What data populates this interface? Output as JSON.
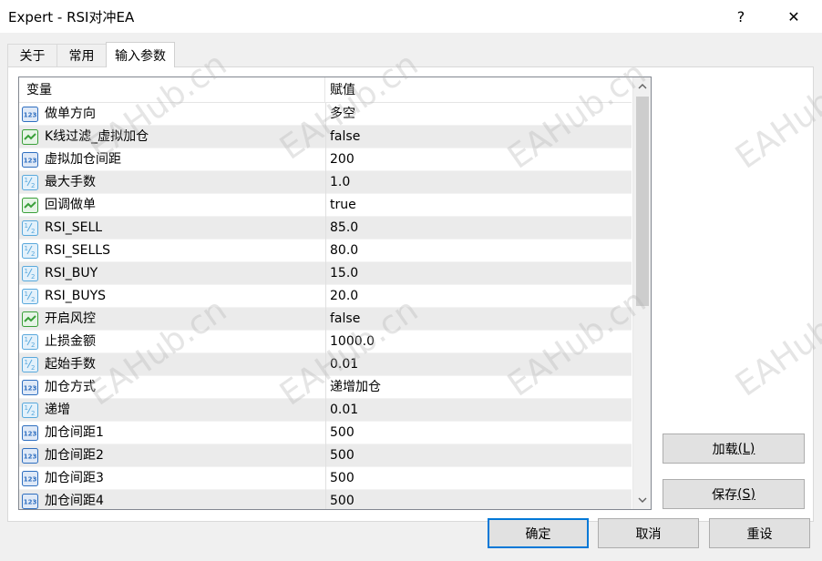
{
  "window": {
    "title": "Expert - RSI对冲EA",
    "help_label": "?",
    "close_label": "✕"
  },
  "tabs": [
    {
      "label": "关于"
    },
    {
      "label": "常用"
    },
    {
      "label": "输入参数"
    }
  ],
  "grid": {
    "headers": {
      "variable": "变量",
      "value": "赋值"
    },
    "rows": [
      {
        "name": "做单方向",
        "value": "多空",
        "icon": "enum-icon"
      },
      {
        "name": "K线过滤_虚拟加仓",
        "value": "false",
        "icon": "bool-icon"
      },
      {
        "name": "虚拟加仓间距",
        "value": "200",
        "icon": "int-icon"
      },
      {
        "name": "最大手数",
        "value": "1.0",
        "icon": "double-icon"
      },
      {
        "name": "回调做单",
        "value": "true",
        "icon": "bool-icon"
      },
      {
        "name": "RSI_SELL",
        "value": "85.0",
        "icon": "double-icon"
      },
      {
        "name": "RSI_SELLS",
        "value": "80.0",
        "icon": "double-icon"
      },
      {
        "name": "RSI_BUY",
        "value": "15.0",
        "icon": "double-icon"
      },
      {
        "name": "RSI_BUYS",
        "value": "20.0",
        "icon": "double-icon"
      },
      {
        "name": "开启风控",
        "value": "false",
        "icon": "bool-icon"
      },
      {
        "name": "止损金额",
        "value": "1000.0",
        "icon": "double-icon"
      },
      {
        "name": "起始手数",
        "value": "0.01",
        "icon": "double-icon"
      },
      {
        "name": "加仓方式",
        "value": "递增加仓",
        "icon": "enum-icon"
      },
      {
        "name": "递增",
        "value": "0.01",
        "icon": "double-icon"
      },
      {
        "name": "加仓间距1",
        "value": "500",
        "icon": "int-icon"
      },
      {
        "name": "加仓间距2",
        "value": "500",
        "icon": "int-icon"
      },
      {
        "name": "加仓间距3",
        "value": "500",
        "icon": "int-icon"
      },
      {
        "name": "加仓间距4",
        "value": "500",
        "icon": "int-icon"
      }
    ]
  },
  "buttons": {
    "load": {
      "label": "加载",
      "accel": "(L)"
    },
    "save": {
      "label": "保存",
      "accel": "(S)"
    },
    "ok": "确定",
    "cancel": "取消",
    "reset": "重设"
  },
  "watermark": "EAHub.cn",
  "colors": {
    "int_icon": "#2f6fc0",
    "double_icon": "#5aa9dc",
    "bool_icon": "#3aa03a",
    "focus_border": "#0078d7"
  }
}
